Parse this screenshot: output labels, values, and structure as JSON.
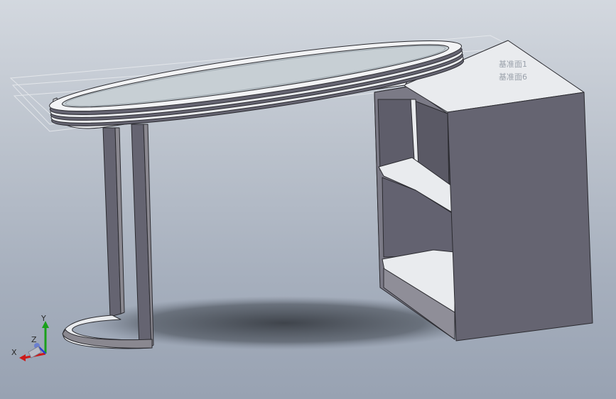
{
  "viewport": {
    "background_top": "#d3d8df",
    "background_bottom": "#98a2b2"
  },
  "model": {
    "name": "oval-desk-with-cabinet",
    "colors": {
      "body": "#656471",
      "edge": "#2b2b30",
      "shelf": "#e9ebee",
      "glass": "#c7cfd4",
      "frame_light": "#f2f3f5",
      "frame_mid": "#8a8890",
      "shadow": "#2e3238"
    }
  },
  "reference_planes": {
    "plane_1": "基准面1",
    "plane_2": "基准面6"
  },
  "triad": {
    "y": "Y",
    "z": "Z",
    "x": "X",
    "colors": {
      "x": "#cc1a1a",
      "y": "#1aa01a",
      "z": "#2a3fd0"
    }
  }
}
